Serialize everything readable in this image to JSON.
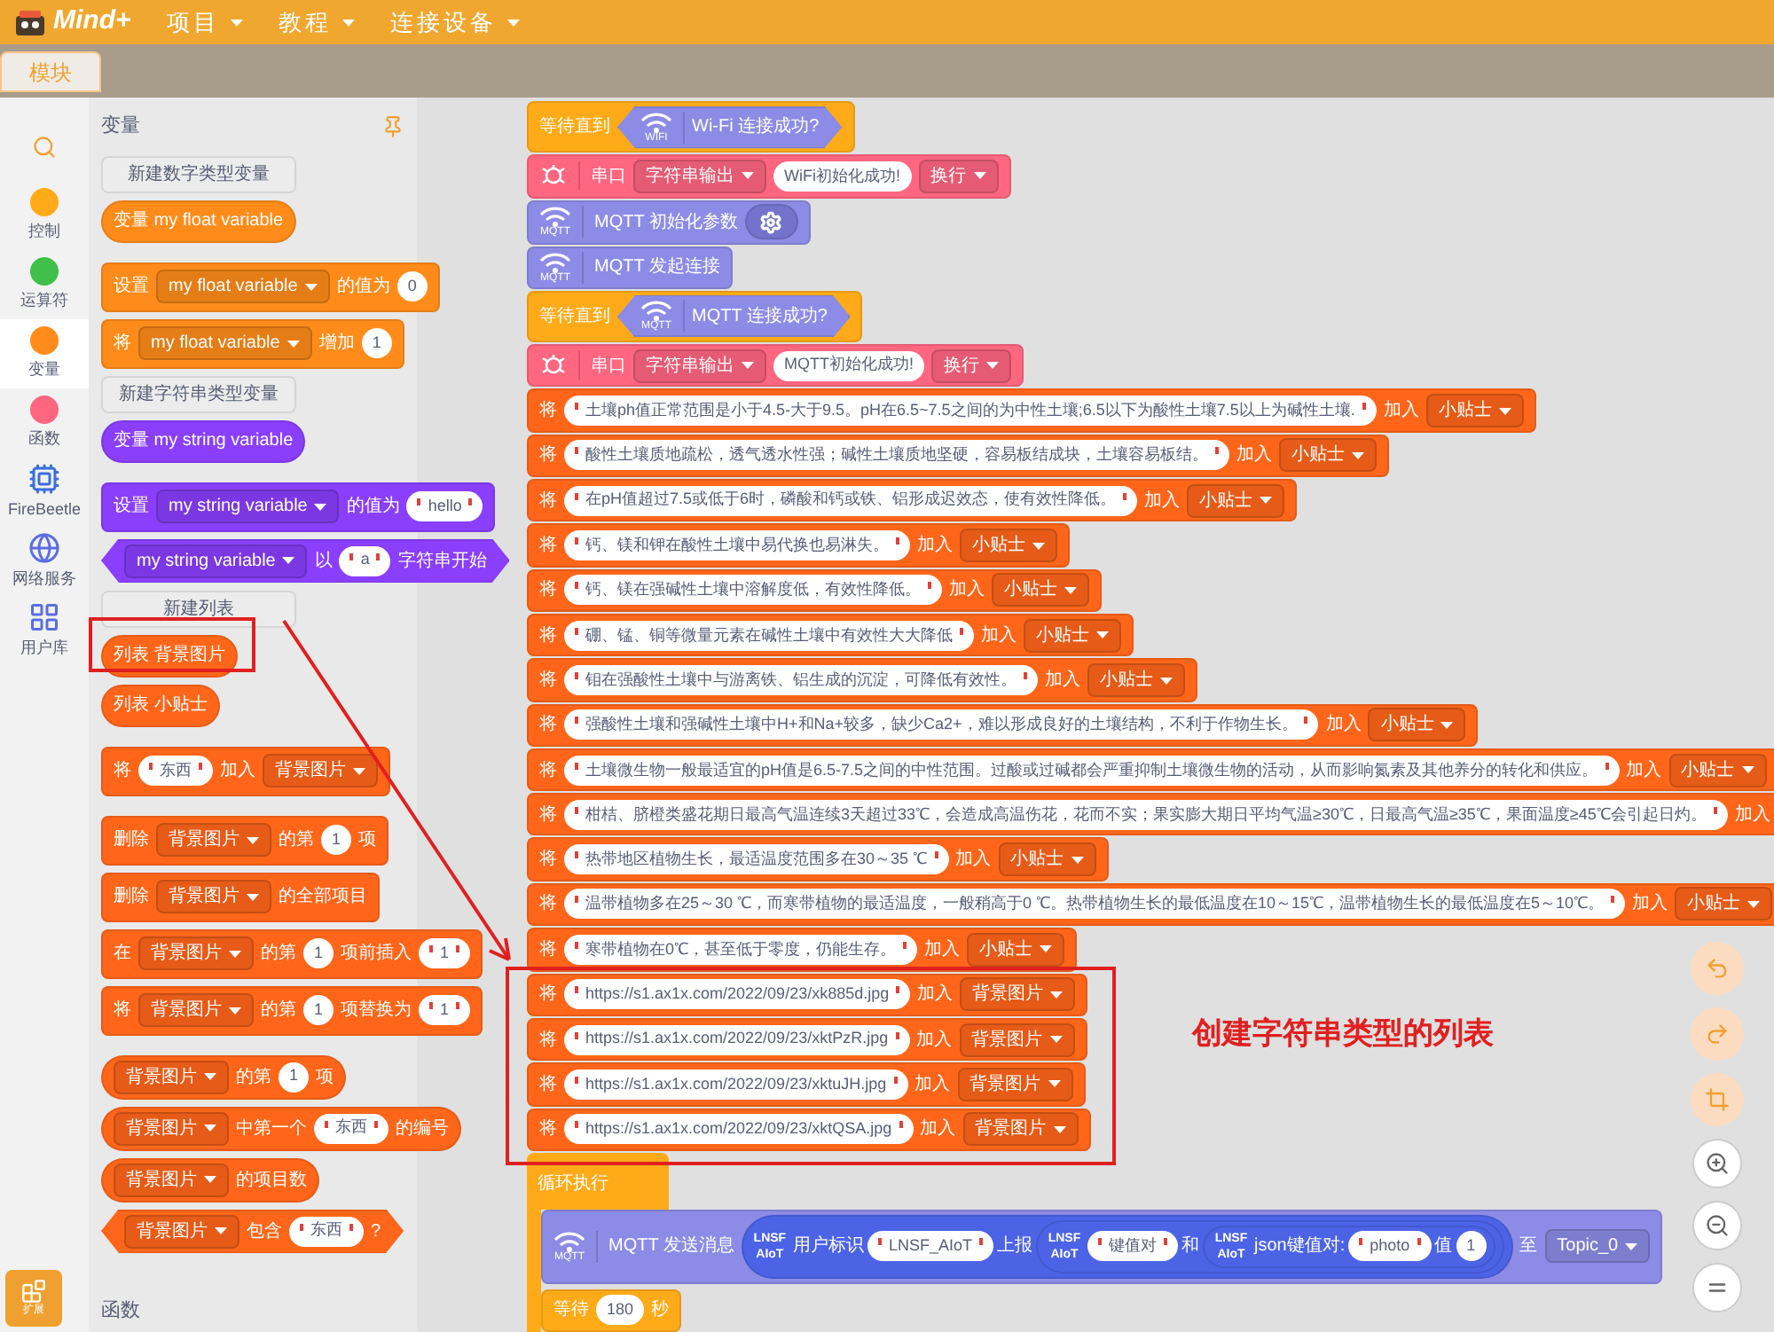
{
  "menu": {
    "logo": "Mind+",
    "items": [
      "项目",
      "教程",
      "连接设备"
    ]
  },
  "tabs": [
    {
      "label": "模块",
      "selected": true
    }
  ],
  "categories": [
    {
      "kind": "search",
      "selected": false
    },
    {
      "kind": "dot",
      "label": "控制",
      "color": "#ffab19",
      "selected": false
    },
    {
      "kind": "dot",
      "label": "运算符",
      "color": "#40bf4a",
      "selected": false
    },
    {
      "kind": "dot",
      "label": "变量",
      "color": "#ff8c1a",
      "selected": true
    },
    {
      "kind": "dot",
      "label": "函数",
      "color": "#ff6680",
      "selected": false
    },
    {
      "kind": "chip",
      "label": "FireBeetle",
      "selected": false
    },
    {
      "kind": "globe",
      "label": "网络服务",
      "selected": false
    },
    {
      "kind": "grid",
      "label": "用户库",
      "selected": false
    }
  ],
  "extension_button": {
    "label": "扩展"
  },
  "palette": {
    "title": "变量",
    "groups": [
      [
        {
          "kind": "button",
          "label": "新建数字类型变量"
        },
        {
          "kind": "reporter",
          "color": "#ff8c1a",
          "parts": [
            {
              "kind": "label",
              "text": "变量 my float variable"
            }
          ]
        }
      ],
      [
        {
          "kind": "stack",
          "color": "#ff8c1a",
          "parts": [
            {
              "kind": "label",
              "text": "设置"
            },
            {
              "kind": "dropdown",
              "text": "my float variable"
            },
            {
              "kind": "label",
              "text": "的值为"
            },
            {
              "kind": "input",
              "text": "0",
              "quoted": false
            }
          ]
        },
        {
          "kind": "stack",
          "color": "#ff8c1a",
          "parts": [
            {
              "kind": "label",
              "text": "将"
            },
            {
              "kind": "dropdown",
              "text": "my float variable"
            },
            {
              "kind": "label",
              "text": "增加"
            },
            {
              "kind": "input",
              "text": "1",
              "quoted": false
            }
          ]
        },
        {
          "kind": "button",
          "label": "新建字符串类型变量"
        },
        {
          "kind": "reporter",
          "color": "#8a3ffc",
          "parts": [
            {
              "kind": "label",
              "text": "变量 my string variable"
            }
          ]
        }
      ],
      [
        {
          "kind": "stack",
          "color": "#8a3ffc",
          "parts": [
            {
              "kind": "label",
              "text": "设置"
            },
            {
              "kind": "dropdown",
              "text": "my string variable"
            },
            {
              "kind": "label",
              "text": "的值为"
            },
            {
              "kind": "input",
              "text": "hello",
              "quoted": true
            }
          ]
        },
        {
          "kind": "boolean",
          "color": "#8a3ffc",
          "parts": [
            {
              "kind": "dropdown",
              "text": "my string variable"
            },
            {
              "kind": "label",
              "text": "以"
            },
            {
              "kind": "input",
              "text": "a",
              "quoted": true
            },
            {
              "kind": "label",
              "text": "字符串开始"
            }
          ]
        },
        {
          "kind": "button",
          "label": "新建列表"
        },
        {
          "kind": "reporter",
          "color": "#ff661a",
          "parts": [
            {
              "kind": "label",
              "text": "列表 背景图片"
            }
          ]
        },
        {
          "kind": "reporter",
          "color": "#ff661a",
          "parts": [
            {
              "kind": "label",
              "text": "列表 小贴士"
            }
          ]
        }
      ],
      [
        {
          "kind": "stack",
          "color": "#ff661a",
          "parts": [
            {
              "kind": "label",
              "text": "将"
            },
            {
              "kind": "input",
              "text": "东西",
              "quoted": true
            },
            {
              "kind": "label",
              "text": "加入"
            },
            {
              "kind": "dropdown",
              "text": "背景图片"
            }
          ]
        }
      ],
      [
        {
          "kind": "stack",
          "color": "#ff661a",
          "parts": [
            {
              "kind": "label",
              "text": "删除"
            },
            {
              "kind": "dropdown",
              "text": "背景图片"
            },
            {
              "kind": "label",
              "text": "的第"
            },
            {
              "kind": "input",
              "text": "1",
              "quoted": false
            },
            {
              "kind": "label",
              "text": "项"
            }
          ]
        },
        {
          "kind": "stack",
          "color": "#ff661a",
          "parts": [
            {
              "kind": "label",
              "text": "删除"
            },
            {
              "kind": "dropdown",
              "text": "背景图片"
            },
            {
              "kind": "label",
              "text": "的全部项目"
            }
          ]
        },
        {
          "kind": "stack",
          "color": "#ff661a",
          "parts": [
            {
              "kind": "label",
              "text": "在"
            },
            {
              "kind": "dropdown",
              "text": "背景图片"
            },
            {
              "kind": "label",
              "text": "的第"
            },
            {
              "kind": "input",
              "text": "1",
              "quoted": false
            },
            {
              "kind": "label",
              "text": "项前插入"
            },
            {
              "kind": "input",
              "text": "1",
              "quoted": true
            }
          ]
        },
        {
          "kind": "stack",
          "color": "#ff661a",
          "parts": [
            {
              "kind": "label",
              "text": "将"
            },
            {
              "kind": "dropdown",
              "text": "背景图片"
            },
            {
              "kind": "label",
              "text": "的第"
            },
            {
              "kind": "input",
              "text": "1",
              "quoted": false
            },
            {
              "kind": "label",
              "text": "项替换为"
            },
            {
              "kind": "input",
              "text": "1",
              "quoted": true
            }
          ]
        }
      ],
      [
        {
          "kind": "reporter",
          "color": "#ff661a",
          "parts": [
            {
              "kind": "dropdown",
              "text": "背景图片"
            },
            {
              "kind": "label",
              "text": "的第"
            },
            {
              "kind": "input",
              "text": "1",
              "quoted": false
            },
            {
              "kind": "label",
              "text": "项"
            }
          ]
        },
        {
          "kind": "reporter",
          "color": "#ff661a",
          "parts": [
            {
              "kind": "dropdown",
              "text": "背景图片"
            },
            {
              "kind": "label",
              "text": "中第一个"
            },
            {
              "kind": "input",
              "text": "东西",
              "quoted": true
            },
            {
              "kind": "label",
              "text": "的编号"
            }
          ]
        },
        {
          "kind": "reporter",
          "color": "#ff661a",
          "parts": [
            {
              "kind": "dropdown",
              "text": "背景图片"
            },
            {
              "kind": "label",
              "text": "的项目数"
            }
          ]
        },
        {
          "kind": "boolean",
          "color": "#ff661a",
          "parts": [
            {
              "kind": "dropdown",
              "text": "背景图片"
            },
            {
              "kind": "label",
              "text": "包含"
            },
            {
              "kind": "input",
              "text": "东西",
              "quoted": true
            },
            {
              "kind": "label",
              "text": "?"
            }
          ]
        }
      ]
    ],
    "next_section": "函数"
  },
  "script": [
    {
      "kind": "stack",
      "color": "#ffab19",
      "parts": [
        {
          "kind": "label",
          "text": "等待直到"
        },
        {
          "kind": "boolean",
          "color": "#8c8ce6",
          "parts": [
            {
              "kind": "wifi",
              "caption": "WIFI"
            },
            {
              "kind": "label",
              "text": "Wi-Fi 连接成功?"
            }
          ]
        }
      ]
    },
    {
      "kind": "stack",
      "color": "#ff6680",
      "parts": [
        {
          "kind": "serial"
        },
        {
          "kind": "label",
          "text": "串口"
        },
        {
          "kind": "dropdown",
          "text": "字符串输出"
        },
        {
          "kind": "input",
          "text": "WiFi初始化成功!",
          "quoted": false
        },
        {
          "kind": "dropdown",
          "text": "换行"
        }
      ]
    },
    {
      "kind": "stack",
      "color": "#8c8ce6",
      "parts": [
        {
          "kind": "wifi",
          "caption": "MQTT"
        },
        {
          "kind": "label",
          "text": "MQTT 初始化参数"
        },
        {
          "kind": "gear"
        }
      ]
    },
    {
      "kind": "stack",
      "color": "#8c8ce6",
      "parts": [
        {
          "kind": "wifi",
          "caption": "MQTT"
        },
        {
          "kind": "label",
          "text": "MQTT 发起连接"
        }
      ]
    },
    {
      "kind": "stack",
      "color": "#ffab19",
      "parts": [
        {
          "kind": "label",
          "text": "等待直到"
        },
        {
          "kind": "boolean",
          "color": "#8c8ce6",
          "parts": [
            {
              "kind": "wifi",
              "caption": "MQTT"
            },
            {
              "kind": "label",
              "text": "MQTT 连接成功?"
            }
          ]
        }
      ]
    },
    {
      "kind": "stack",
      "color": "#ff6680",
      "parts": [
        {
          "kind": "serial"
        },
        {
          "kind": "label",
          "text": "串口"
        },
        {
          "kind": "dropdown",
          "text": "字符串输出"
        },
        {
          "kind": "input",
          "text": "MQTT初始化成功!",
          "quoted": false
        },
        {
          "kind": "dropdown",
          "text": "换行"
        }
      ]
    },
    {
      "kind": "stack",
      "color": "#ff661a",
      "parts": [
        {
          "kind": "label",
          "text": "将"
        },
        {
          "kind": "input",
          "text": "土壤ph值正常范围是小于4.5-大于9.5。pH在6.5~7.5之间的为中性土壤;6.5以下为酸性土壤7.5以上为碱性土壤.",
          "quoted": true
        },
        {
          "kind": "label",
          "text": "加入"
        },
        {
          "kind": "dropdown",
          "text": "小贴士"
        }
      ]
    },
    {
      "kind": "stack",
      "color": "#ff661a",
      "parts": [
        {
          "kind": "label",
          "text": "将"
        },
        {
          "kind": "input",
          "text": "酸性土壤质地疏松，透气透水性强；碱性土壤质地坚硬，容易板结成块，土壤容易板结。",
          "quoted": true
        },
        {
          "kind": "label",
          "text": "加入"
        },
        {
          "kind": "dropdown",
          "text": "小贴士"
        }
      ]
    },
    {
      "kind": "stack",
      "color": "#ff661a",
      "parts": [
        {
          "kind": "label",
          "text": "将"
        },
        {
          "kind": "input",
          "text": "在pH值超过7.5或低于6时，磷酸和钙或铁、铝形成迟效态，使有效性降低。",
          "quoted": true
        },
        {
          "kind": "label",
          "text": "加入"
        },
        {
          "kind": "dropdown",
          "text": "小贴士"
        }
      ]
    },
    {
      "kind": "stack",
      "color": "#ff661a",
      "parts": [
        {
          "kind": "label",
          "text": "将"
        },
        {
          "kind": "input",
          "text": "钙、镁和钾在酸性土壤中易代换也易淋失。",
          "quoted": true
        },
        {
          "kind": "label",
          "text": "加入"
        },
        {
          "kind": "dropdown",
          "text": "小贴士"
        }
      ]
    },
    {
      "kind": "stack",
      "color": "#ff661a",
      "parts": [
        {
          "kind": "label",
          "text": "将"
        },
        {
          "kind": "input",
          "text": "钙、镁在强碱性土壤中溶解度低，有效性降低。",
          "quoted": true
        },
        {
          "kind": "label",
          "text": "加入"
        },
        {
          "kind": "dropdown",
          "text": "小贴士"
        }
      ]
    },
    {
      "kind": "stack",
      "color": "#ff661a",
      "parts": [
        {
          "kind": "label",
          "text": "将"
        },
        {
          "kind": "input",
          "text": "硼、锰、铜等微量元素在碱性土壤中有效性大大降低",
          "quoted": true
        },
        {
          "kind": "label",
          "text": "加入"
        },
        {
          "kind": "dropdown",
          "text": "小贴士"
        }
      ]
    },
    {
      "kind": "stack",
      "color": "#ff661a",
      "parts": [
        {
          "kind": "label",
          "text": "将"
        },
        {
          "kind": "input",
          "text": "钼在强酸性土壤中与游离铁、铝生成的沉淀，可降低有效性。",
          "quoted": true
        },
        {
          "kind": "label",
          "text": "加入"
        },
        {
          "kind": "dropdown",
          "text": "小贴士"
        }
      ]
    },
    {
      "kind": "stack",
      "color": "#ff661a",
      "parts": [
        {
          "kind": "label",
          "text": "将"
        },
        {
          "kind": "input",
          "text": "强酸性土壤和强碱性土壤中H+和Na+较多，缺少Ca2+，难以形成良好的土壤结构，不利于作物生长。",
          "quoted": true
        },
        {
          "kind": "label",
          "text": "加入"
        },
        {
          "kind": "dropdown",
          "text": "小贴士"
        }
      ]
    },
    {
      "kind": "stack",
      "color": "#ff661a",
      "parts": [
        {
          "kind": "label",
          "text": "将"
        },
        {
          "kind": "input",
          "text": "土壤微生物一般最适宜的pH值是6.5-7.5之间的中性范围。过酸或过碱都会严重抑制土壤微生物的活动，从而影响氮素及其他养分的转化和供应。",
          "quoted": true
        },
        {
          "kind": "label",
          "text": "加入"
        },
        {
          "kind": "dropdown",
          "text": "小贴士"
        }
      ]
    },
    {
      "kind": "stack",
      "color": "#ff661a",
      "parts": [
        {
          "kind": "label",
          "text": "将"
        },
        {
          "kind": "input",
          "text": "柑桔、脐橙类盛花期日最高气温连续3天超过33℃，会造成高温伤花，花而不实；果实膨大期日平均气温≥30℃，日最高气温≥35℃，果面温度≥45℃会引起日灼。",
          "quoted": true
        },
        {
          "kind": "label",
          "text": "加入"
        }
      ]
    },
    {
      "kind": "stack",
      "color": "#ff661a",
      "parts": [
        {
          "kind": "label",
          "text": "将"
        },
        {
          "kind": "input",
          "text": "热带地区植物生长，最适温度范围多在30～35 ℃",
          "quoted": true
        },
        {
          "kind": "label",
          "text": "加入"
        },
        {
          "kind": "dropdown",
          "text": "小贴士"
        }
      ]
    },
    {
      "kind": "stack",
      "color": "#ff661a",
      "parts": [
        {
          "kind": "label",
          "text": "将"
        },
        {
          "kind": "input",
          "text": "温带植物多在25～30 ℃，而寒带植物的最适温度，一般稍高于0 ℃。热带植物生长的最低温度在10～15℃，温带植物生长的最低温度在5～10℃。",
          "quoted": true
        },
        {
          "kind": "label",
          "text": "加入"
        },
        {
          "kind": "dropdown",
          "text": "小贴士"
        }
      ]
    },
    {
      "kind": "stack",
      "color": "#ff661a",
      "parts": [
        {
          "kind": "label",
          "text": "将"
        },
        {
          "kind": "input",
          "text": "寒带植物在0℃，甚至低于零度，仍能生存。",
          "quoted": true
        },
        {
          "kind": "label",
          "text": "加入"
        },
        {
          "kind": "dropdown",
          "text": "小贴士"
        }
      ]
    },
    {
      "kind": "stack",
      "color": "#ff661a",
      "parts": [
        {
          "kind": "label",
          "text": "将"
        },
        {
          "kind": "input",
          "text": "https://s1.ax1x.com/2022/09/23/xk885d.jpg",
          "quoted": true
        },
        {
          "kind": "label",
          "text": "加入"
        },
        {
          "kind": "dropdown",
          "text": "背景图片"
        }
      ]
    },
    {
      "kind": "stack",
      "color": "#ff661a",
      "parts": [
        {
          "kind": "label",
          "text": "将"
        },
        {
          "kind": "input",
          "text": "https://s1.ax1x.com/2022/09/23/xktPzR.jpg",
          "quoted": true
        },
        {
          "kind": "label",
          "text": "加入"
        },
        {
          "kind": "dropdown",
          "text": "背景图片"
        }
      ]
    },
    {
      "kind": "stack",
      "color": "#ff661a",
      "parts": [
        {
          "kind": "label",
          "text": "将"
        },
        {
          "kind": "input",
          "text": "https://s1.ax1x.com/2022/09/23/xktuJH.jpg",
          "quoted": true
        },
        {
          "kind": "label",
          "text": "加入"
        },
        {
          "kind": "dropdown",
          "text": "背景图片"
        }
      ]
    },
    {
      "kind": "stack",
      "color": "#ff661a",
      "parts": [
        {
          "kind": "label",
          "text": "将"
        },
        {
          "kind": "input",
          "text": "https://s1.ax1x.com/2022/09/23/xktQSA.jpg",
          "quoted": true
        },
        {
          "kind": "label",
          "text": "加入"
        },
        {
          "kind": "dropdown",
          "text": "背景图片"
        }
      ]
    },
    {
      "kind": "loop",
      "label": "循环执行",
      "color": "#ffab19",
      "children": [
        {
          "kind": "stack",
          "color": "#8c8ce6",
          "parts": [
            {
              "kind": "wifi",
              "caption": "MQTT"
            },
            {
              "kind": "label",
              "text": "MQTT 发送消息"
            },
            {
              "kind": "reporter",
              "color": "#4c63e6",
              "parts": [
                {
                  "kind": "badge",
                  "text": "LNSF AIoT"
                },
                {
                  "kind": "label",
                  "text": "用户标识"
                },
                {
                  "kind": "input",
                  "text": "LNSF_AIoT",
                  "quoted": true
                },
                {
                  "kind": "label",
                  "text": "上报"
                },
                {
                  "kind": "reporter",
                  "color": "#4c63e6",
                  "parts": [
                    {
                      "kind": "badge",
                      "text": "LNSF AIoT"
                    },
                    {
                      "kind": "input",
                      "text": "键值对",
                      "quoted": true
                    },
                    {
                      "kind": "label",
                      "text": "和"
                    },
                    {
                      "kind": "reporter",
                      "color": "#4c63e6",
                      "parts": [
                        {
                          "kind": "badge",
                          "text": "LNSF AIoT"
                        },
                        {
                          "kind": "label",
                          "text": "json键值对:"
                        },
                        {
                          "kind": "input",
                          "text": "photo",
                          "quoted": true
                        },
                        {
                          "kind": "label",
                          "text": "值"
                        },
                        {
                          "kind": "input",
                          "text": "1",
                          "quoted": false
                        }
                      ]
                    }
                  ]
                }
              ]
            },
            {
              "kind": "label",
              "text": "至"
            },
            {
              "kind": "dropdown",
              "text": "Topic_0"
            }
          ]
        },
        {
          "kind": "stack",
          "color": "#ffab19",
          "parts": [
            {
              "kind": "label",
              "text": "等待"
            },
            {
              "kind": "input",
              "text": "180",
              "quoted": false
            },
            {
              "kind": "label",
              "text": "秒"
            }
          ]
        }
      ]
    }
  ],
  "annotation": {
    "text": "创建字符串类型的列表"
  }
}
